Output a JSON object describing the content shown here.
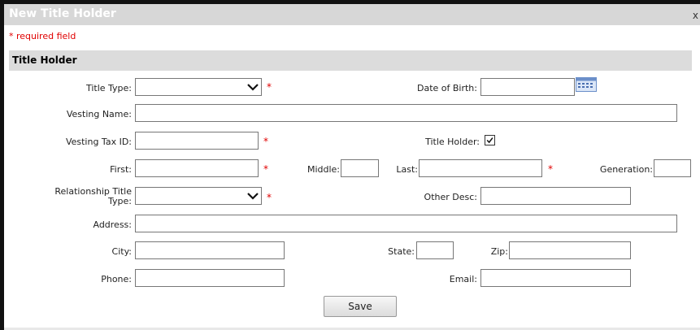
{
  "dialog": {
    "title": "New Title Holder",
    "close_label": "x"
  },
  "required_note": "* required field",
  "section": {
    "title": "Title Holder"
  },
  "required_mark": "*",
  "fields": {
    "title_type": {
      "label": "Title Type:",
      "value": ""
    },
    "date_of_birth": {
      "label": "Date of Birth:",
      "value": ""
    },
    "vesting_name": {
      "label": "Vesting Name:",
      "value": ""
    },
    "vesting_tax_id": {
      "label": "Vesting Tax ID:",
      "value": ""
    },
    "title_holder": {
      "label": "Title Holder:",
      "checked": true
    },
    "first": {
      "label": "First:",
      "value": ""
    },
    "middle": {
      "label": "Middle:",
      "value": ""
    },
    "last": {
      "label": "Last:",
      "value": ""
    },
    "generation": {
      "label": "Generation:",
      "value": ""
    },
    "relationship_title_type": {
      "label": "Relationship Title Type:",
      "value": ""
    },
    "other_desc": {
      "label": "Other Desc:",
      "value": ""
    },
    "address": {
      "label": "Address:",
      "value": ""
    },
    "city": {
      "label": "City:",
      "value": ""
    },
    "state": {
      "label": "State:",
      "value": ""
    },
    "zip": {
      "label": "Zip:",
      "value": ""
    },
    "phone": {
      "label": "Phone:",
      "value": ""
    },
    "email": {
      "label": "Email:",
      "value": ""
    }
  },
  "buttons": {
    "save": "Save"
  },
  "icons": {
    "calendar": "calendar-icon",
    "dropdown": "chevron-down-icon",
    "checkbox": "checkmark-icon"
  },
  "colors": {
    "required": "#e00000",
    "header_bg": "#d7d7d7",
    "section_bg": "#dcdcdc"
  }
}
